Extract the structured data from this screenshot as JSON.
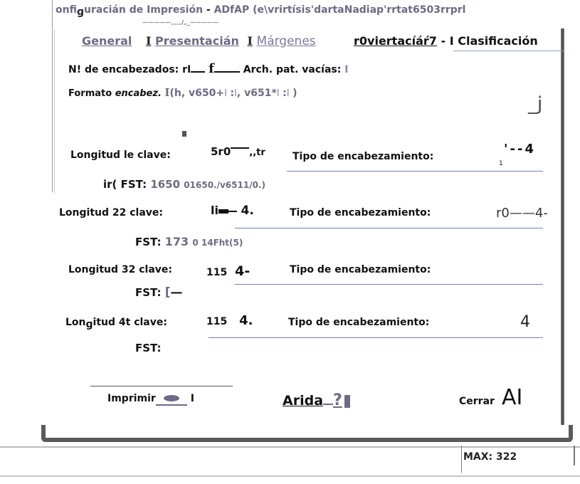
{
  "window": {
    "title_part1": "onfi",
    "title_part2": "uracián de Impresión",
    "title_sep": "-",
    "title_part3": "ADfAP (e\\vrirtísis'dartaNadiap'rrtat6503rrprl",
    "title_mark": "—————,,,,,,/,,_—————"
  },
  "tabs": {
    "general": "General",
    "sep1": "I",
    "presentacion": "Presentacián",
    "sep2": "I",
    "margenes": "Márgenes",
    "conversion": "r0viertac",
    "conversion_tail": "íáŕ7",
    "clas_sep": "-",
    "clasificacion": "I Clasificación"
  },
  "general": {
    "num_encabezados_label": "N! de encabezados: rI",
    "num_encabezados_val": "f",
    "arch_label": "Arch. pat. vacías:",
    "arch_val": "I",
    "formato_label": "Formato",
    "formato_label_em": "encabez.",
    "formato_i1": "I",
    "formato_v1": "(h, v650+",
    "formato_i2": "I",
    "formato_colon1": ":",
    "formato_i3": "I",
    "formato_v2": ", v651*",
    "formato_i4": "I",
    "formato_colon2": ":",
    "formato_i5": "I",
    "formato_close": ")",
    "corner_mark": "_j"
  },
  "keys": [
    {
      "label": "Longitud le clave:",
      "value": "5r0",
      "value_suffix": ",,tr",
      "tipo_label": "Tipo de encabezamiento:",
      "tipo_prefix": "1",
      "tipo_value": "'--4",
      "fst_label": "ir( FST:",
      "fst_num": "1650",
      "fst_expr": "01650./v6511/0.)"
    },
    {
      "label": "Longitud 22 clave:",
      "value": "li",
      "value_suffix": "4.",
      "tipo_label": "Tipo de encabezamiento:",
      "tipo_value": "r0——4-",
      "fst_label": "FST:",
      "fst_num": "173",
      "fst_expr": "0 14Fht(5)"
    },
    {
      "label": "Longitud 32 clave:",
      "value": "115",
      "value_suffix": "4-",
      "tipo_label": "Tipo de encabezamiento:",
      "tipo_value": "",
      "fst_label": "FST:",
      "fst_num": "[",
      "fst_expr": "—"
    },
    {
      "label_part1": "Lon",
      "label_part2": "itud 4t clave:",
      "value": "115",
      "value_suffix": "4.",
      "tipo_label": "Tipo de encabezamiento:",
      "tipo_value": "4",
      "fst_label": "FST:",
      "fst_num": "",
      "fst_expr": ""
    }
  ],
  "buttons": {
    "imprimir": "Imprimir",
    "imprimir_tail": "I",
    "ayuda": "Arida",
    "ayuda_mark": "?",
    "cerrar": "Cerrar",
    "cerrar_mark": "AI"
  },
  "status": {
    "max": "MAX: 322"
  }
}
